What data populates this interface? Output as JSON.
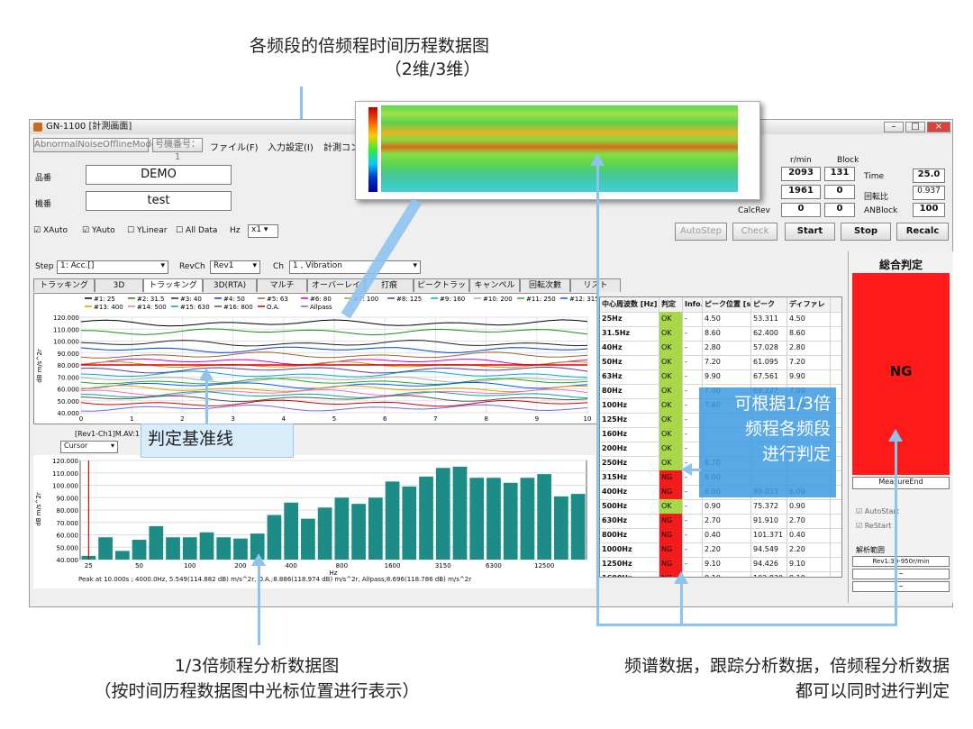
{
  "annotations": {
    "top_title": "各频段的倍频程时间历程数据图",
    "top_sub": "（2维/3维）",
    "criteria": "判定基准线",
    "judge_callout": "可根据1/3倍\n频程各频段\n进行判定",
    "bottom_left_1": "1/3倍频程分析数据图",
    "bottom_left_2": "（按时间历程数据图中光标位置进行表示）",
    "bottom_right_1": "频谱数据，跟踪分析数据，倍频程分析数据",
    "bottom_right_2": "都可以同时进行判定"
  },
  "window": {
    "title": "GN-1100 [計測画面]",
    "mode_button": "AbnormalNoiseOfflineMode",
    "machine_button": "号機番号：1",
    "menu": [
      "ファイル(F)",
      "入力設定(I)",
      "計測コン"
    ],
    "fields": {
      "product_label": "品番",
      "product_value": "DEMO",
      "machine_label": "機番",
      "machine_value": "test"
    },
    "stats": {
      "headers": [
        "r/min",
        "Block"
      ],
      "rows": [
        [
          "2093",
          "131"
        ],
        [
          "1961",
          "0"
        ],
        [
          "0",
          "0"
        ]
      ],
      "row_labels": [
        "",
        "",
        "CalcRev"
      ],
      "right_labels": [
        "Time",
        "回転比",
        "ANBlock"
      ],
      "right_values": [
        "25.0",
        "0.937",
        "100"
      ]
    },
    "checks": [
      "XAuto",
      "YAuto",
      "YLinear",
      "All Data"
    ],
    "hz_label": "Hz",
    "hz_value": "x1",
    "buttons": [
      "AutoStep",
      "Check",
      "Start",
      "Stop",
      "Recalc"
    ],
    "step_label": "Step",
    "step_value": "1: Acc.[]",
    "revch_label": "RevCh",
    "revch_value": "Rev1",
    "ch_label": "Ch",
    "ch_value": "1 , Vibration",
    "tabs": [
      "トラッキング",
      "3D",
      "トラッキング(RTA)",
      "3D(RTA)",
      "マルチ",
      "オーバーレイ",
      "打痕",
      "ピークトラッキング",
      "キャンペル",
      "回転次數",
      "リスト"
    ],
    "legend": [
      "#1: 25",
      "#2: 31.5",
      "#3: 40",
      "#4: 50",
      "#5: 63",
      "#6: 80",
      "#7: 100",
      "#8: 125",
      "#9: 160",
      "#10: 200",
      "#11: 250",
      "#12: 315",
      "#13: 400",
      "#14: 500",
      "#15: 630",
      "#16: 800",
      "O.A.",
      "Allpass"
    ],
    "cursor_label": "[Rev1-Ch1]M.AV:1",
    "cursor_select": "Cursor",
    "peak_text": "Peak at 10.000s ; 4000.0Hz, 5.549(114.882 dB) m/s^2r, O.A.;8.886(118.974 dB) m/s^2r, Allpass;8.696(118.786 dB) m/s^2r",
    "judge_title": "総合判定",
    "judge_result": "NG",
    "judge_status": "MeasureEnd",
    "auto_start": "AutoStart",
    "re_start": "ReStart",
    "range_label": "解析範囲",
    "range_value": "Rev1:30-950r/min",
    "range_extra": [
      "~",
      "~"
    ],
    "table_headers": [
      "中心周波数 [Hz]",
      "判定",
      "Info.",
      "ピーク位置 [s]",
      "ピーク",
      "ディファレ"
    ],
    "table_rows": [
      [
        "25Hz",
        "OK",
        "-",
        "4.50",
        "53.311",
        "4.50"
      ],
      [
        "31.5Hz",
        "OK",
        "-",
        "8.60",
        "62.400",
        "8.60"
      ],
      [
        "40Hz",
        "OK",
        "-",
        "2.80",
        "57.028",
        "2.80"
      ],
      [
        "50Hz",
        "OK",
        "-",
        "7.20",
        "61.095",
        "7.20"
      ],
      [
        "63Hz",
        "OK",
        "-",
        "9.90",
        "67.561",
        "9.90"
      ],
      [
        "80Hz",
        "OK",
        "-",
        "7.00",
        "69.227",
        "7.00"
      ],
      [
        "100Hz",
        "OK",
        "-",
        "7.60",
        "62.078",
        "7.60"
      ],
      [
        "125Hz",
        "OK",
        "-",
        "",
        "",
        ""
      ],
      [
        "160Hz",
        "OK",
        "-",
        "",
        "",
        ""
      ],
      [
        "200Hz",
        "OK",
        "-",
        "",
        "",
        ""
      ],
      [
        "250Hz",
        "OK",
        "-",
        "8.70",
        "",
        ""
      ],
      [
        "315Hz",
        "NG",
        "-",
        "6.00",
        "",
        ""
      ],
      [
        "400Hz",
        "NG",
        "-",
        "6.00",
        "89.033",
        "6.00"
      ],
      [
        "500Hz",
        "OK",
        "-",
        "0.90",
        "75.372",
        "0.90"
      ],
      [
        "630Hz",
        "NG",
        "-",
        "2.70",
        "91.910",
        "2.70"
      ],
      [
        "800Hz",
        "NG",
        "-",
        "0.40",
        "101.371",
        "0.40"
      ],
      [
        "1000Hz",
        "NG",
        "-",
        "2.20",
        "94.549",
        "2.20"
      ],
      [
        "1250Hz",
        "NG",
        "-",
        "9.10",
        "94.426",
        "9.10"
      ],
      [
        "1600Hz",
        "NG",
        "-",
        "9.10",
        "102.830",
        "9.10"
      ]
    ],
    "top_chart": {
      "ylabel": "dB m/s^2r",
      "xlabel": "s",
      "yticks": [
        "120.000",
        "110.000",
        "100.000",
        "90.000",
        "80.000",
        "70.000",
        "60.000",
        "50.000",
        "40.000"
      ],
      "xticks": [
        "0",
        "1",
        "2",
        "3",
        "4",
        "5",
        "6",
        "7",
        "8",
        "9",
        "10"
      ]
    },
    "bottom_chart": {
      "ylabel": "dB m/s^2r",
      "xlabel": "Hz",
      "yticks": [
        "120.000",
        "110.000",
        "100.000",
        "90.000",
        "80.000",
        "70.000",
        "60.000",
        "50.000",
        "40.000"
      ],
      "xticks": [
        "25",
        "50",
        "100",
        "200",
        "400",
        "800",
        "1600",
        "3150",
        "6300",
        "12500"
      ]
    }
  },
  "chart_data": {
    "type": "bar",
    "title": "",
    "xlabel": "Hz",
    "ylabel": "dB m/s^2r",
    "ylim": [
      40,
      120
    ],
    "categories": [
      "25",
      "31.5",
      "40",
      "50",
      "63",
      "80",
      "100",
      "125",
      "160",
      "200",
      "250",
      "315",
      "400",
      "500",
      "630",
      "800",
      "1000",
      "1250",
      "1600",
      "2000",
      "2500",
      "3150",
      "4000",
      "5000",
      "6300",
      "8000",
      "10000",
      "12500",
      "16000",
      "20000"
    ],
    "values": [
      43,
      58,
      47,
      56,
      67,
      58,
      58,
      62,
      58,
      57,
      61,
      76,
      86,
      73,
      82,
      90,
      85,
      90,
      103,
      99,
      107,
      114,
      115,
      106,
      106,
      102,
      106,
      109,
      91,
      93
    ],
    "colors": {
      "bar": "#1d8c86",
      "cursor": "#e00000"
    }
  }
}
